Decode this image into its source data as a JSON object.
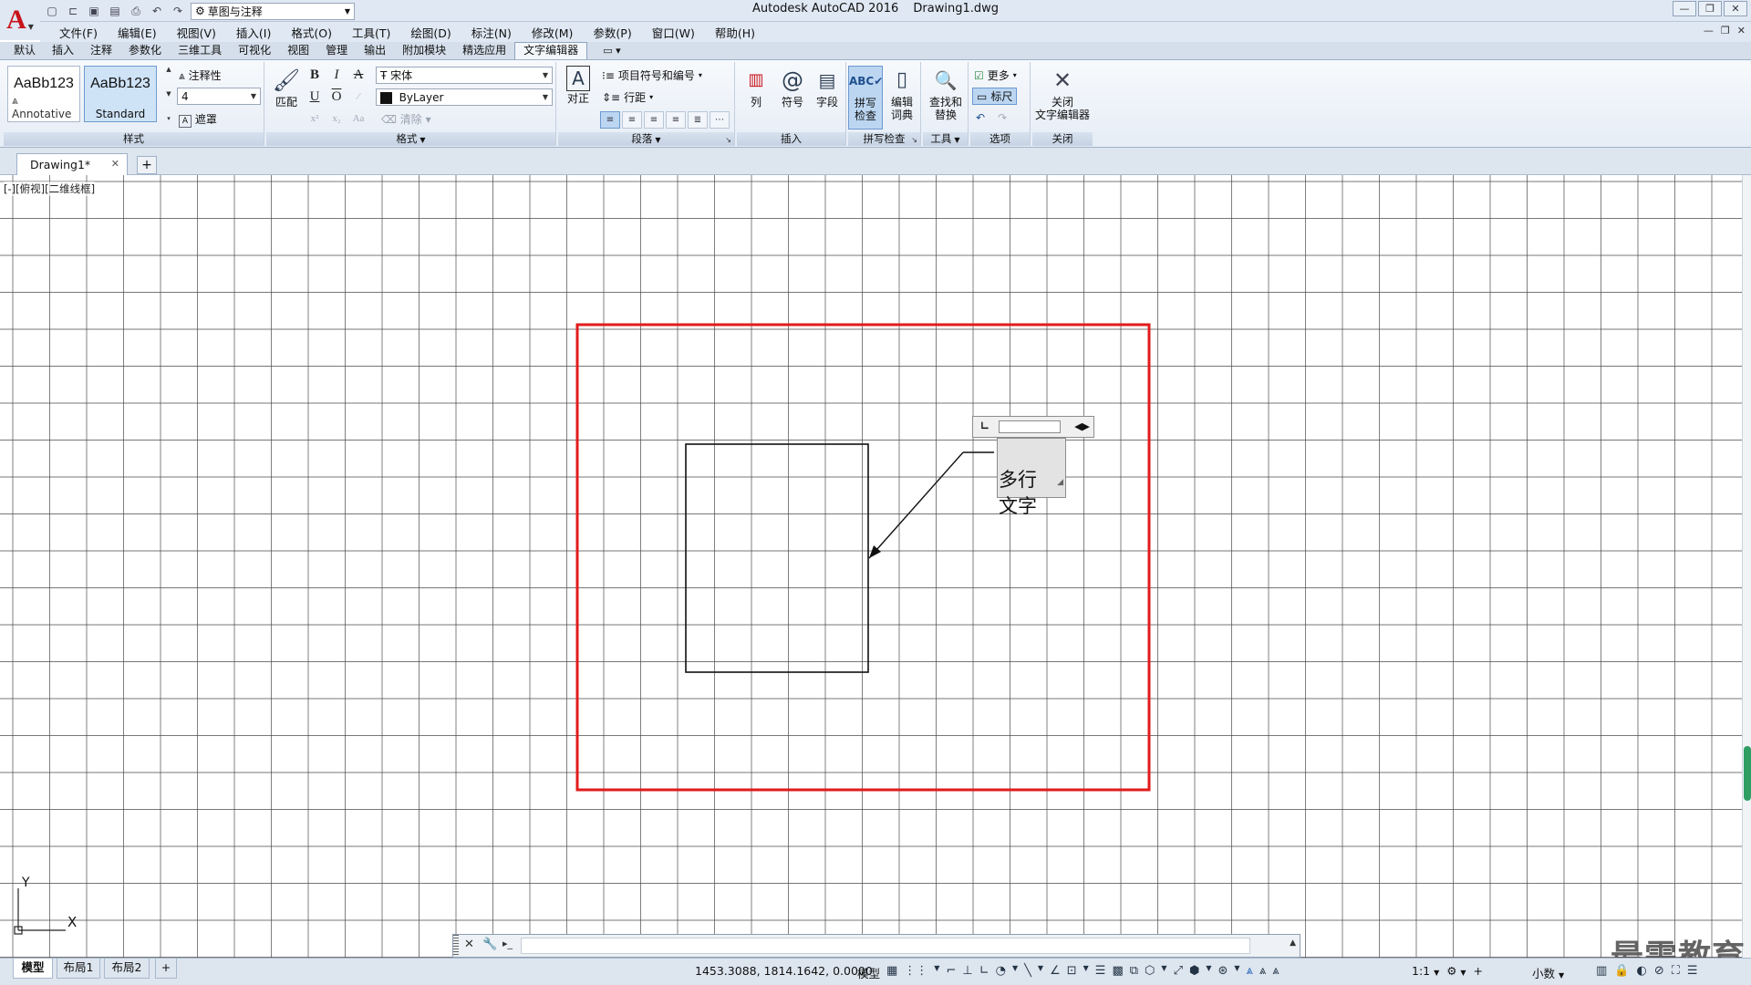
{
  "title_bar": {
    "app_name": "Autodesk AutoCAD 2016",
    "document_name": "Drawing1.dwg",
    "workspace": "草图与注释",
    "quick_access_icons": [
      "new-icon",
      "open-icon",
      "save-icon",
      "save-as-icon",
      "plot-icon",
      "undo-icon",
      "redo-icon",
      "gear-icon"
    ]
  },
  "menu": [
    "文件(F)",
    "编辑(E)",
    "视图(V)",
    "插入(I)",
    "格式(O)",
    "工具(T)",
    "绘图(D)",
    "标注(N)",
    "修改(M)",
    "参数(P)",
    "窗口(W)",
    "帮助(H)"
  ],
  "ribbon_tabs": [
    "默认",
    "插入",
    "注释",
    "参数化",
    "三维工具",
    "可视化",
    "视图",
    "管理",
    "输出",
    "附加模块",
    "精选应用",
    "文字编辑器"
  ],
  "ribbon_active_tab": "文字编辑器",
  "ribbon": {
    "style": {
      "title": "样式",
      "swatches": [
        {
          "sample": "AaBb123",
          "name": "Annotative",
          "selected": false
        },
        {
          "sample": "AaBb123",
          "name": "Standard",
          "selected": true
        }
      ],
      "annotative_label": "注释性",
      "text_height": "4",
      "mask_label": "遮罩"
    },
    "format": {
      "title": "格式",
      "match_label": "匹配",
      "font": "宋体",
      "color": "ByLayer",
      "clear_label": "清除",
      "buttons": [
        "B",
        "I",
        "A",
        "U",
        "O"
      ]
    },
    "paragraph": {
      "title": "段落",
      "justify_label": "对正",
      "bullets_label": "项目符号和编号",
      "line_spacing_label": "行距"
    },
    "insert": {
      "title": "插入",
      "columns_label": "列",
      "symbol_label": "符号",
      "field_label": "字段"
    },
    "spell": {
      "title": "拼写检查",
      "spell_check_label": "拼写\n检查",
      "edit_dict_label": "编辑\n词典"
    },
    "tools": {
      "title": "工具",
      "find_replace_label": "查找和\n替换"
    },
    "options": {
      "title": "选项",
      "more_label": "更多",
      "ruler_label": "标尺"
    },
    "close": {
      "title": "关闭",
      "close_label": "关闭\n文字编辑器"
    }
  },
  "doc_tab": {
    "name": "Drawing1*"
  },
  "canvas": {
    "viewport_label": "[-][俯视][二维线框]",
    "mtext": "多行\n文字",
    "ucs_x": "X",
    "ucs_y": "Y"
  },
  "layout_tabs": [
    "模型",
    "布局1",
    "布局2"
  ],
  "status": {
    "coordinates": "1453.3088, 1814.1642, 0.0000",
    "space": "模型",
    "scale": "1:1",
    "units": "小数"
  },
  "watermark": "最需教育",
  "colors": {
    "highlight_box": "#e21b1b",
    "ribbon_active": "#bcd6f2",
    "autocad_red": "#c8141b",
    "scroll_thumb": "#2f9e63"
  }
}
